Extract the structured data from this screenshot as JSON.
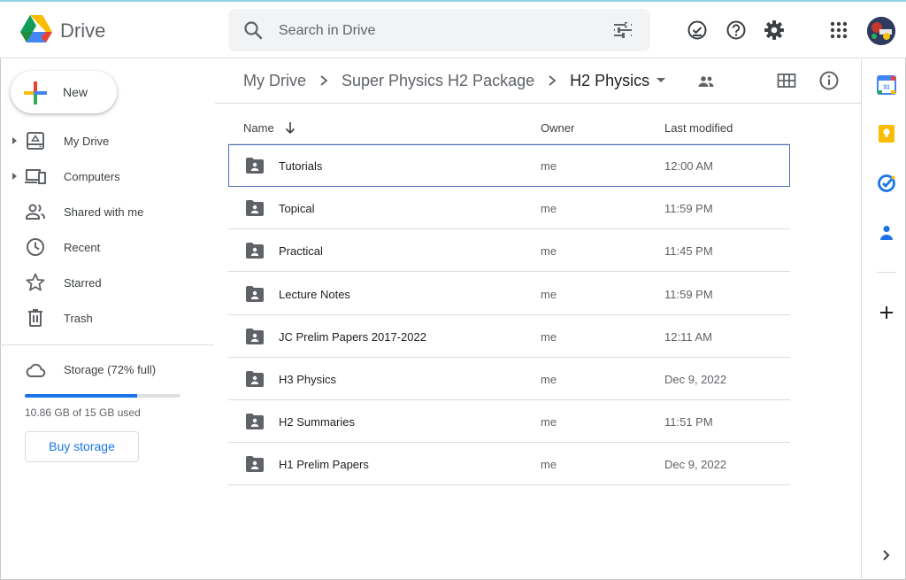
{
  "app": {
    "name": "Drive",
    "logo_icon": "google-drive-logo"
  },
  "search": {
    "placeholder": "Search in Drive",
    "icon": "search-icon",
    "filter_icon": "tune-icon"
  },
  "header_icons": [
    "ready-for-offline-icon",
    "help-icon",
    "settings-icon",
    "apps-grid-icon",
    "account-avatar"
  ],
  "sidebar": {
    "new_label": "New",
    "items": [
      {
        "label": "My Drive",
        "icon": "my-drive-icon",
        "expandable": true
      },
      {
        "label": "Computers",
        "icon": "computers-icon",
        "expandable": true
      },
      {
        "label": "Shared with me",
        "icon": "people-icon",
        "expandable": false
      },
      {
        "label": "Recent",
        "icon": "clock-icon",
        "expandable": false
      },
      {
        "label": "Starred",
        "icon": "star-icon",
        "expandable": false
      },
      {
        "label": "Trash",
        "icon": "trash-icon",
        "expandable": false
      }
    ],
    "storage": {
      "label": "Storage (72% full)",
      "used_text": "10.86 GB of 15 GB used",
      "fraction": 0.72,
      "buy_label": "Buy storage"
    }
  },
  "breadcrumb": [
    "My Drive",
    "Super Physics H2 Package",
    "H2 Physics"
  ],
  "table": {
    "columns": [
      "Name",
      "Owner",
      "Last modified"
    ],
    "sort": "Name descending",
    "rows": [
      {
        "name": "Tutorials",
        "owner": "me",
        "modified": "12:00 AM",
        "selected": true
      },
      {
        "name": "Topical",
        "owner": "me",
        "modified": "11:59 PM"
      },
      {
        "name": "Practical",
        "owner": "me",
        "modified": "11:45 PM"
      },
      {
        "name": "Lecture Notes",
        "owner": "me",
        "modified": "11:59 PM"
      },
      {
        "name": "JC Prelim Papers 2017-2022",
        "owner": "me",
        "modified": "12:11 AM"
      },
      {
        "name": "H3 Physics",
        "owner": "me",
        "modified": "Dec 9, 2022"
      },
      {
        "name": "H2 Summaries",
        "owner": "me",
        "modified": "11:51 PM"
      },
      {
        "name": "H1 Prelim Papers",
        "owner": "me",
        "modified": "Dec 9, 2022"
      }
    ]
  },
  "side_panel": [
    "calendar-icon",
    "keep-icon",
    "tasks-icon",
    "contacts-icon",
    "add-icon",
    "expand-panel-icon"
  ],
  "colors": {
    "accent": "#1a73e8",
    "selection_border": "#4a6fb5",
    "keep": "#fbbc04",
    "tasks": "#1a73e8",
    "contacts": "#1a73e8"
  }
}
